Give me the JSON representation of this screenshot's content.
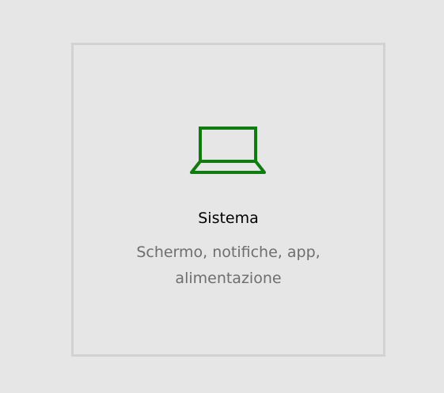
{
  "tile": {
    "title": "Sistema",
    "description_line1": "Schermo, notifiche, app,",
    "description_line2": "alimentazione",
    "icon": "laptop-icon",
    "accent_color": "#107c10"
  }
}
